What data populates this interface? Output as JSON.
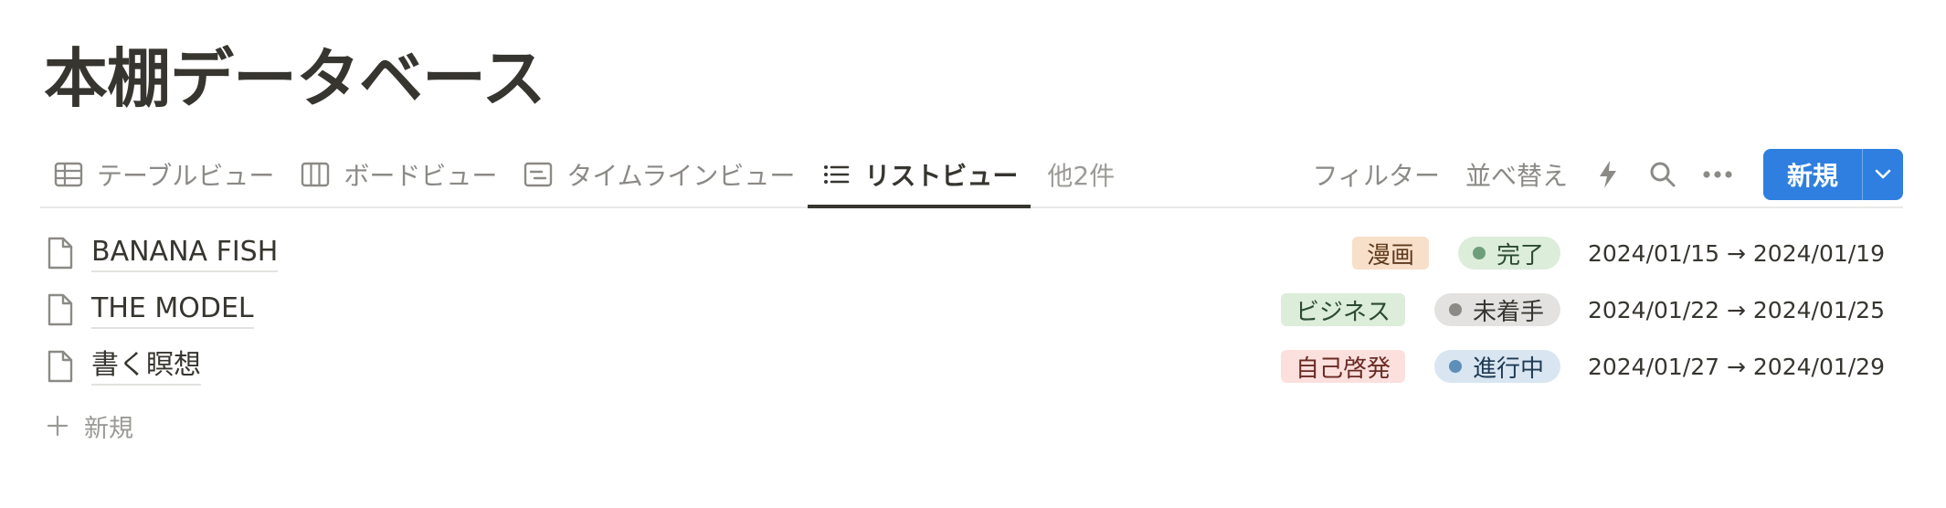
{
  "page": {
    "title": "本棚データベース"
  },
  "views": {
    "tabs": [
      {
        "label": "テーブルビュー",
        "icon": "table-icon",
        "active": false
      },
      {
        "label": "ボードビュー",
        "icon": "board-icon",
        "active": false
      },
      {
        "label": "タイムラインビュー",
        "icon": "timeline-icon",
        "active": false
      },
      {
        "label": "リストビュー",
        "icon": "list-icon",
        "active": true
      }
    ],
    "more_label": "他2件"
  },
  "toolbar": {
    "filter_label": "フィルター",
    "sort_label": "並べ替え",
    "automation_icon": "lightning-icon",
    "search_icon": "search-icon",
    "more_icon": "ellipsis-icon",
    "new_label": "新規",
    "new_dropdown_icon": "chevron-down-icon",
    "accent_color": "#2f7fe0"
  },
  "items": [
    {
      "title": "BANANA FISH",
      "tag": {
        "label": "漫画",
        "bg": "#f8dfc9",
        "color": "#5f3a1e"
      },
      "status": {
        "label": "完了",
        "bg": "#dcedd9",
        "dot": "#6f9f7a",
        "color": "#2b4a31"
      },
      "dates": "2024/01/15 → 2024/01/19"
    },
    {
      "title": "THE MODEL",
      "tag": {
        "label": "ビジネス",
        "bg": "#dcedd9",
        "color": "#2b4a31"
      },
      "status": {
        "label": "未着手",
        "bg": "#e3e2e0",
        "dot": "#8c8a86",
        "color": "#37352f"
      },
      "dates": "2024/01/22 → 2024/01/25"
    },
    {
      "title": "書く瞑想",
      "tag": {
        "label": "自己啓発",
        "bg": "#fbe0de",
        "color": "#6b2a24"
      },
      "status": {
        "label": "進行中",
        "bg": "#d9e6f1",
        "dot": "#5d8fb8",
        "color": "#1f3a53"
      },
      "dates": "2024/01/27 → 2024/01/29"
    }
  ],
  "add_row": {
    "label": "新規",
    "icon": "plus-icon"
  }
}
